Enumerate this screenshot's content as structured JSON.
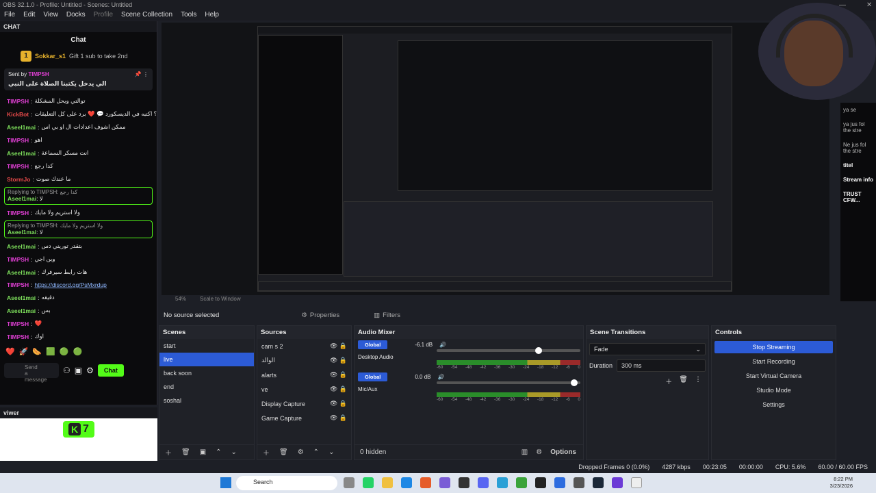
{
  "window": {
    "title": "OBS 32.1.0 - Profile: Untitled - Scenes: Untitled"
  },
  "menu": [
    "File",
    "Edit",
    "View",
    "Docks",
    "Profile",
    "Scene Collection",
    "Tools",
    "Help"
  ],
  "chat_dock": {
    "header": "CHAT",
    "title": "Chat",
    "top_gifter": {
      "name": "Sokkar_s1",
      "rank": "1",
      "count": "1",
      "gift_text": "Gift 1 sub to take 2nd"
    },
    "pinned": {
      "sent_by_label": "Sent by",
      "sender": "TIMPSH",
      "message": "الي يدخل يكتبنا الصلاة على النبي"
    },
    "messages": [
      {
        "user": "TIMPSH",
        "text": "توالتي ويحل المشكلة",
        "color": "pink"
      },
      {
        "user": "KickBot",
        "text": "عندك سؤال أو اقتراح؟ اكتبه في الديسكورد 💬 ❤️ برد على كل التعليقات",
        "color": "red"
      },
      {
        "user": "Aseel1mai",
        "text": "ممكن اشوف اعدادات ال او بي اس",
        "color": "green"
      },
      {
        "user": "TIMPSH",
        "text": "اهو",
        "color": "pink"
      },
      {
        "user": "Aseel1mai",
        "text": "انت مسكر السماعة",
        "color": "green"
      },
      {
        "user": "TIMPSH",
        "text": "كدا رجع",
        "color": "pink"
      },
      {
        "user": "StormJo",
        "text": "ما عندك صوت",
        "color": "red"
      }
    ],
    "replies": [
      {
        "reply_to": "Replying to TIMPSH: كدا رجع",
        "user": "Aseel1mai",
        "text": "لا"
      },
      {
        "reply_to": "Replying to TIMPSH: ولا استريم ولا مايك",
        "user": "Aseel1mai",
        "text": "لا"
      }
    ],
    "between_reply": {
      "user": "TIMPSH",
      "text": "ولا استريم ولا مايك"
    },
    "messages2": [
      {
        "user": "Aseel1mai",
        "text": "بتقدر توريني دس",
        "color": "green"
      },
      {
        "user": "TIMPSH",
        "text": "وين اجي",
        "color": "pink"
      },
      {
        "user": "Aseel1mai",
        "text": "هات رابط سيرفرك",
        "color": "green"
      },
      {
        "user": "TIMPSH",
        "text": "https://discord.gg/PsMxrdup",
        "color": "pink",
        "link": true
      },
      {
        "user": "Aseel1mai",
        "text": "دقيقه",
        "color": "green"
      },
      {
        "user": "Aseel1mai",
        "text": "بس",
        "color": "green"
      },
      {
        "user": "TIMPSH",
        "text": "❤️",
        "color": "pink"
      },
      {
        "user": "TIMPSH",
        "text": "اوك",
        "color": "pink"
      }
    ],
    "send_placeholder": "Send a message",
    "chat_button": "Chat"
  },
  "viewer_dock": {
    "header": "viwer",
    "badge_letter": "K",
    "badge_value": "7"
  },
  "preview": {
    "zoom": "54%",
    "scale_label": "Scale to Window",
    "right_strip": [
      {
        "a": "ya",
        "b": "se"
      },
      {
        "a": "ya",
        "b": "jus fol the stre"
      },
      {
        "a": "Ne",
        "b": "jus fol the stre"
      }
    ],
    "right_bottom": {
      "title": "titel",
      "stream_info": "Stream info",
      "trust": "TRUST CFW..."
    }
  },
  "source_bar": {
    "status": "No source selected",
    "properties": "Properties",
    "filters": "Filters"
  },
  "scenes": {
    "title": "Scenes",
    "items": [
      "start",
      "live",
      "back soon",
      "end",
      "soshal"
    ],
    "selected": "live"
  },
  "sources": {
    "title": "Sources",
    "items": [
      "cam s 2",
      "الوالد",
      "alarts",
      "ve",
      "Display Capture",
      "Game Capture"
    ]
  },
  "audio_mixer": {
    "title": "Audio Mixer",
    "channels": [
      {
        "name": "Desktop Audio",
        "badge": "Global",
        "db": "-6.1 dB",
        "volume": 0.72
      },
      {
        "name": "Mic/Aux",
        "badge": "Global",
        "db": "0.0 dB",
        "volume": 0.98
      }
    ],
    "ticks": [
      "-60",
      "-54",
      "-48",
      "-42",
      "-36",
      "-30",
      "-24",
      "-18",
      "-12",
      "-6",
      "0"
    ],
    "hidden": "0 hidden",
    "options": "Options"
  },
  "scene_transitions": {
    "title": "Scene Transitions",
    "transition": "Fade",
    "duration_label": "Duration",
    "duration": "300 ms"
  },
  "controls": {
    "title": "Controls",
    "buttons": [
      "Stop Streaming",
      "Start Recording",
      "Start Virtual Camera",
      "Studio Mode",
      "Settings"
    ]
  },
  "status_bar": {
    "dropped": "Dropped Frames 0 (0.0%)",
    "bitrate": "4287 kbps",
    "stream_time": "00:23:05",
    "rec_time": "00:00:00",
    "cpu": "CPU: 5.6%",
    "fps": "60.00 / 60.00 FPS"
  },
  "taskbar": {
    "search": "Search",
    "time": "8:22 PM",
    "date": "3/23/2026"
  },
  "colors": {
    "accent": "#2c5bd6",
    "kick_green": "#53fc18",
    "pink_user": "#e03fd4",
    "green_user": "#7ee05c"
  }
}
